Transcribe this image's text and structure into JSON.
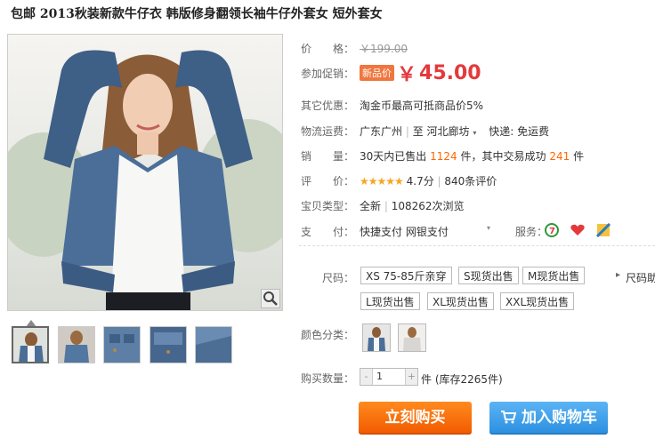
{
  "title": "包邮 2013秋装新款牛仔衣 韩版修身翻领长袖牛仔外套女 短外套女",
  "price": {
    "label": "价　　格：",
    "original": "￥199.00"
  },
  "promo": {
    "label": "参加促销：",
    "badge": "新品价",
    "currency": "￥",
    "price": "45.00"
  },
  "discount": {
    "label": "其它优惠：",
    "text": "淘金币最高可抵商品价5%"
  },
  "shipping": {
    "label": "物流运费：",
    "from": "广东广州",
    "to_word": "至",
    "to": "河北廊坊",
    "express": "快递: 免运费"
  },
  "sales": {
    "label": "销　　量：",
    "prefix": "30天内已售出",
    "sold": "1124",
    "mid": "件，其中交易成功",
    "success": "241",
    "suffix": "件"
  },
  "rating": {
    "label": "评　　价：",
    "stars": "★★★★★",
    "score": "4.7分",
    "reviews": "840条评价"
  },
  "item_type": {
    "label": "宝贝类型：",
    "condition": "全新",
    "views": "108262次浏览"
  },
  "payment": {
    "label": "支　　付：",
    "methods": "快捷支付  网银支付",
    "service_label": "服务："
  },
  "size": {
    "label": "尺码：",
    "options": [
      "XS 75-85斤亲穿",
      "S现货出售",
      "M现货出售",
      "L现货出售",
      "XL现货出售",
      "XXL现货出售"
    ],
    "more": "尺码助"
  },
  "color": {
    "label": "颜色分类："
  },
  "quantity": {
    "label": "购买数量：",
    "value": "1",
    "minus": "-",
    "plus": "+",
    "stock": "件 (库存2265件)"
  },
  "buttons": {
    "buy_now": "立刻购买",
    "add_to_cart": "加入购物车"
  },
  "colors": {
    "price_red": "#e4393c",
    "accent_orange": "#f15a00",
    "cart_blue": "#2a8fe0"
  }
}
